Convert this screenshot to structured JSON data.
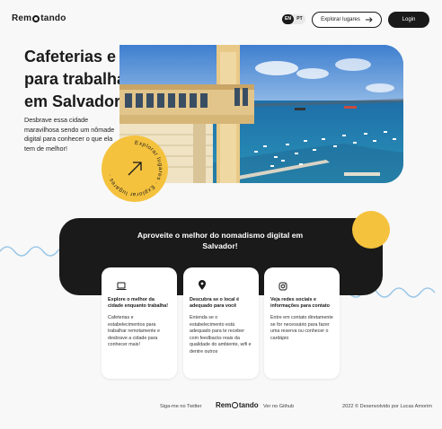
{
  "header": {
    "logo_prefix": "Rem",
    "logo_suffix": "tando",
    "lang_en": "EN",
    "lang_pt": "PT",
    "explore_label": "Explorar lugares",
    "login_label": "Login"
  },
  "hero": {
    "title": "Cafeterias e outros locais para trabalhar remotamente em Salvador",
    "description": "Desbrave essa cidade maravilhosa sendo um nômade digital para conhecer o que ela tem de melhor!",
    "badge_text": "Explorar lugares · Explorar lugares ·"
  },
  "section": {
    "title": "Aproveite o melhor do nomadismo digital em Salvador!"
  },
  "cards": [
    {
      "icon": "laptop-icon",
      "title": "Explore o melhor da cidade enquanto trabalha!",
      "text": "Cafeterias e estabelecimentos para trabalhar remotamente e desbrave a cidade para conhecer mais!"
    },
    {
      "icon": "location-pin-icon",
      "title": "Descubra se o local é adequado para você",
      "text": "Entenda se o estabelecimento está adequado para te receber com feedbacks reais da qualidade do ambiente, wifi e dentre outros"
    },
    {
      "icon": "instagram-icon",
      "title": "Veja redes sociais e informações para contato",
      "text": "Entre em contato diretamente se for necessário para fazer uma reserva ou conhecer o cardápio"
    }
  ],
  "footer": {
    "twitter_label": "Siga-me no Twitter",
    "logo_prefix": "Rem",
    "logo_suffix": "tando",
    "github_label": "Ver no Github",
    "copyright": "2022 © Desenvolvido por Lucas Amorim"
  },
  "colors": {
    "accent_yellow": "#f5c23e",
    "dark": "#1a1a1a",
    "wave_blue": "#9cc8e8"
  }
}
